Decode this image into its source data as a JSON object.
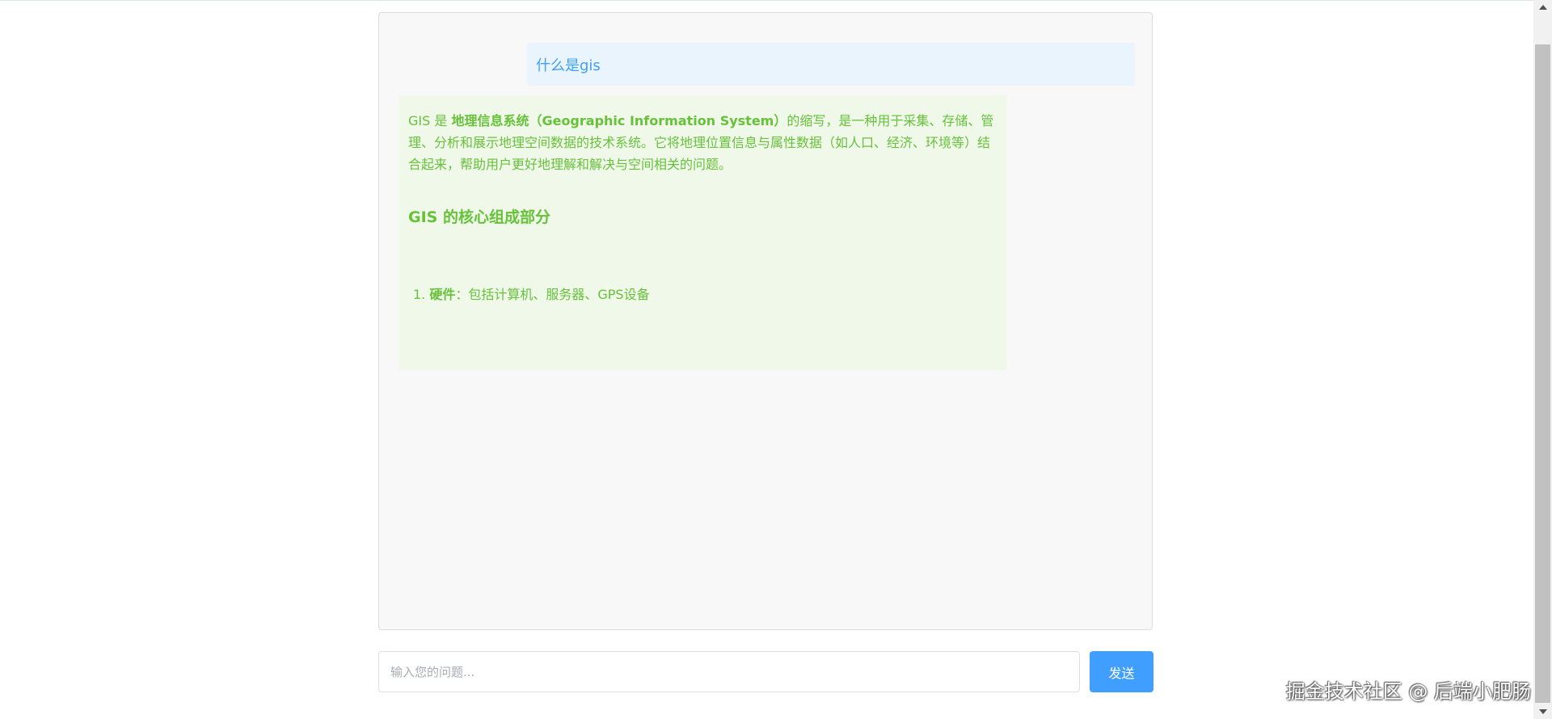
{
  "chat": {
    "user_message": "什么是gis",
    "bot_message": {
      "intro_prefix": "GIS 是 ",
      "intro_bold": "地理信息系统（Geographic Information System）",
      "intro_suffix": "的缩写，是一种用于采集、存储、管理、分析和展示地理空间数据的技术系统。它将地理位置信息与属性数据（如人口、经济、环境等）结合起来，帮助用户更好地理解和解决与空间相关的问题。",
      "heading": "GIS 的核心组成部分",
      "list_items": [
        {
          "number": "1. ",
          "bold": "硬件",
          "text": "：包括计算机、服务器、GPS设备"
        }
      ]
    }
  },
  "input": {
    "placeholder": "输入您的问题..."
  },
  "send_button_label": "发送",
  "watermark": "掘金技术社区 @ 后端小肥肠",
  "colors": {
    "user_text": "#409eff",
    "user_bg": "#e9f4fd",
    "bot_text": "#67c23a",
    "bot_bg": "#eff8e9",
    "button_bg": "#409eff"
  }
}
